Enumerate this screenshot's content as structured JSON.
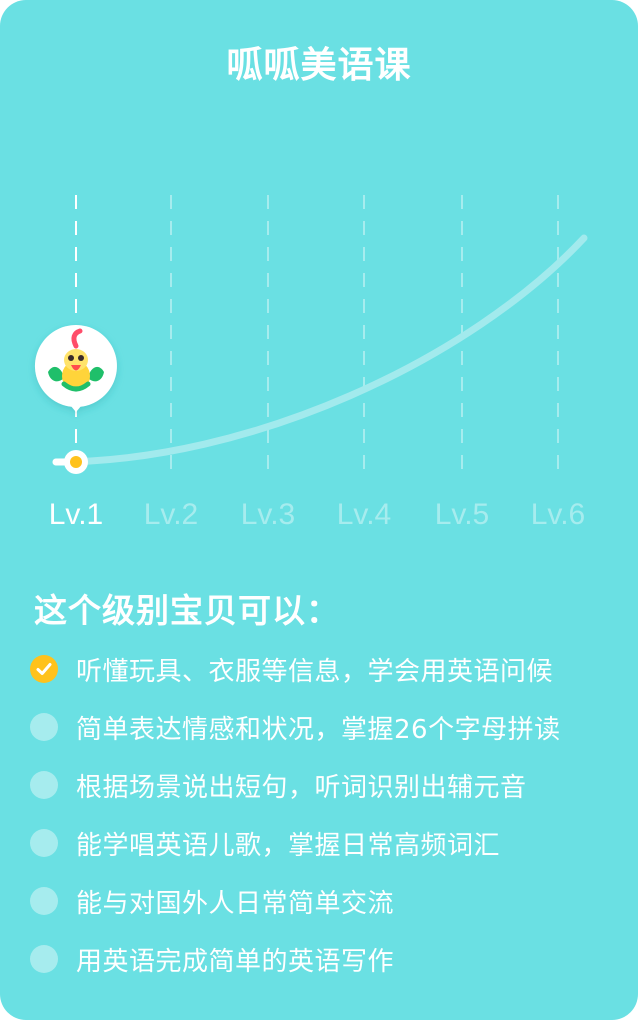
{
  "title": "呱呱美语课",
  "levels": [
    {
      "label": "Lv.1",
      "active": true
    },
    {
      "label": "Lv.2",
      "active": false
    },
    {
      "label": "Lv.3",
      "active": false
    },
    {
      "label": "Lv.4",
      "active": false
    },
    {
      "label": "Lv.5",
      "active": false
    },
    {
      "label": "Lv.6",
      "active": false
    }
  ],
  "current_level": 1,
  "avatar_icon": "parrot-mascot-icon",
  "colors": {
    "background": "#6ae0e3",
    "accent": "#ffc21c",
    "inactive": "#a6ecee",
    "text": "#ffffff"
  },
  "heading": "这个级别宝贝可以：",
  "abilities": [
    {
      "text": "听懂玩具、衣服等信息，学会用英语问候",
      "done": true
    },
    {
      "text": "简单表达情感和状况，掌握26个字母拼读",
      "done": false
    },
    {
      "text": "根据场景说出短句，听词识别出辅元音",
      "done": false
    },
    {
      "text": "能学唱英语儿歌，掌握日常高频词汇",
      "done": false
    },
    {
      "text": "能与对国外人日常简单交流",
      "done": false
    },
    {
      "text": "用英语完成简单的英语写作",
      "done": false
    }
  ]
}
